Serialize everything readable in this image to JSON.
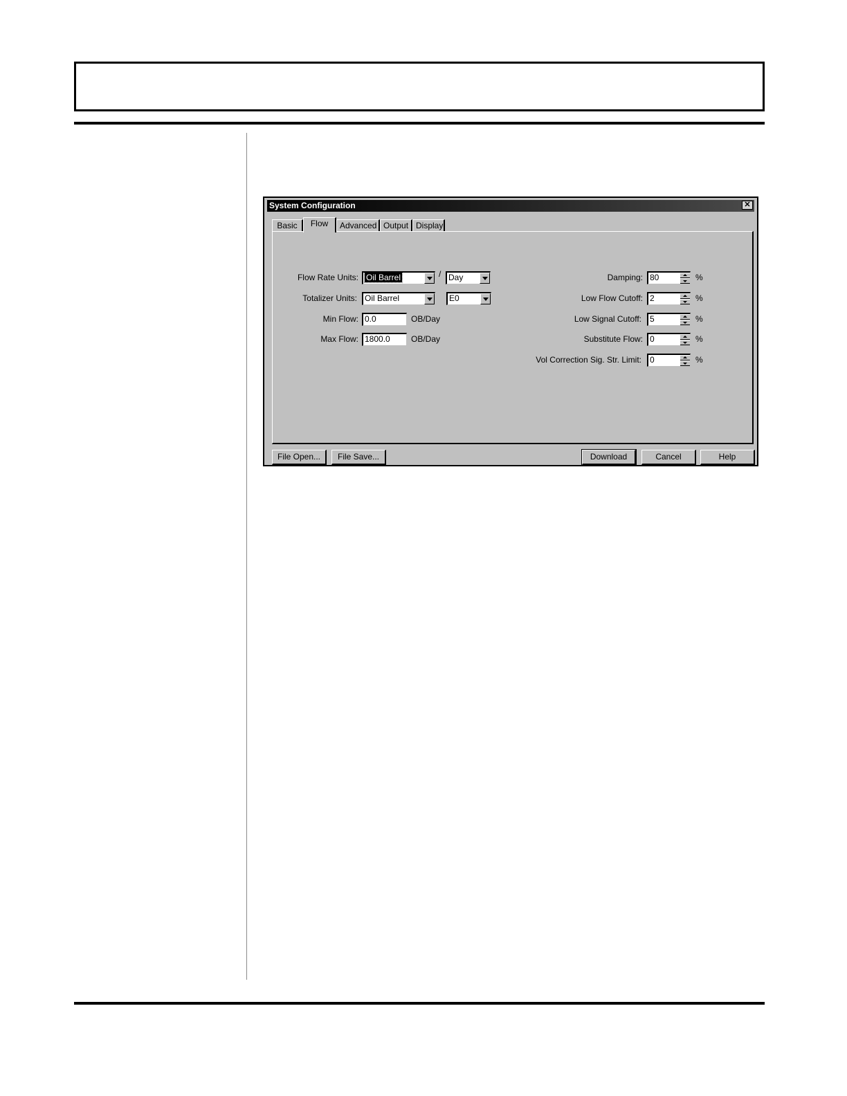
{
  "dialog": {
    "title": "System Configuration",
    "close_symbol": "✕",
    "tabs": [
      "Basic",
      "Flow",
      "Advanced",
      "Output",
      "Display"
    ],
    "active_tab": "Flow"
  },
  "flow": {
    "flow_rate_units": {
      "label": "Flow Rate Units:",
      "value": "Oil Barrel",
      "separator": "/",
      "time_value": "Day"
    },
    "totalizer_units": {
      "label": "Totalizer Units:",
      "value": "Oil Barrel",
      "exponent_value": "E0"
    },
    "min_flow": {
      "label": "Min Flow:",
      "value": "0.0",
      "unit": "OB/Day"
    },
    "max_flow": {
      "label": "Max Flow:",
      "value": "1800.0",
      "unit": "OB/Day"
    },
    "damping": {
      "label": "Damping:",
      "value": "80",
      "unit": "%"
    },
    "low_flow_cutoff": {
      "label": "Low Flow Cutoff:",
      "value": "2",
      "unit": "%"
    },
    "low_signal_cutoff": {
      "label": "Low Signal Cutoff:",
      "value": "5",
      "unit": "%"
    },
    "substitute_flow": {
      "label": "Substitute Flow:",
      "value": "0",
      "unit": "%"
    },
    "vol_correction": {
      "label": "Vol Correction Sig. Str. Limit:",
      "value": "0",
      "unit": "%"
    }
  },
  "buttons": {
    "file_open": "File Open...",
    "file_save": "File Save...",
    "download": "Download",
    "cancel": "Cancel",
    "help": "Help"
  },
  "icons": [
    "close-icon",
    "dropdown-arrow-icon",
    "spin-up-icon",
    "spin-down-icon"
  ]
}
